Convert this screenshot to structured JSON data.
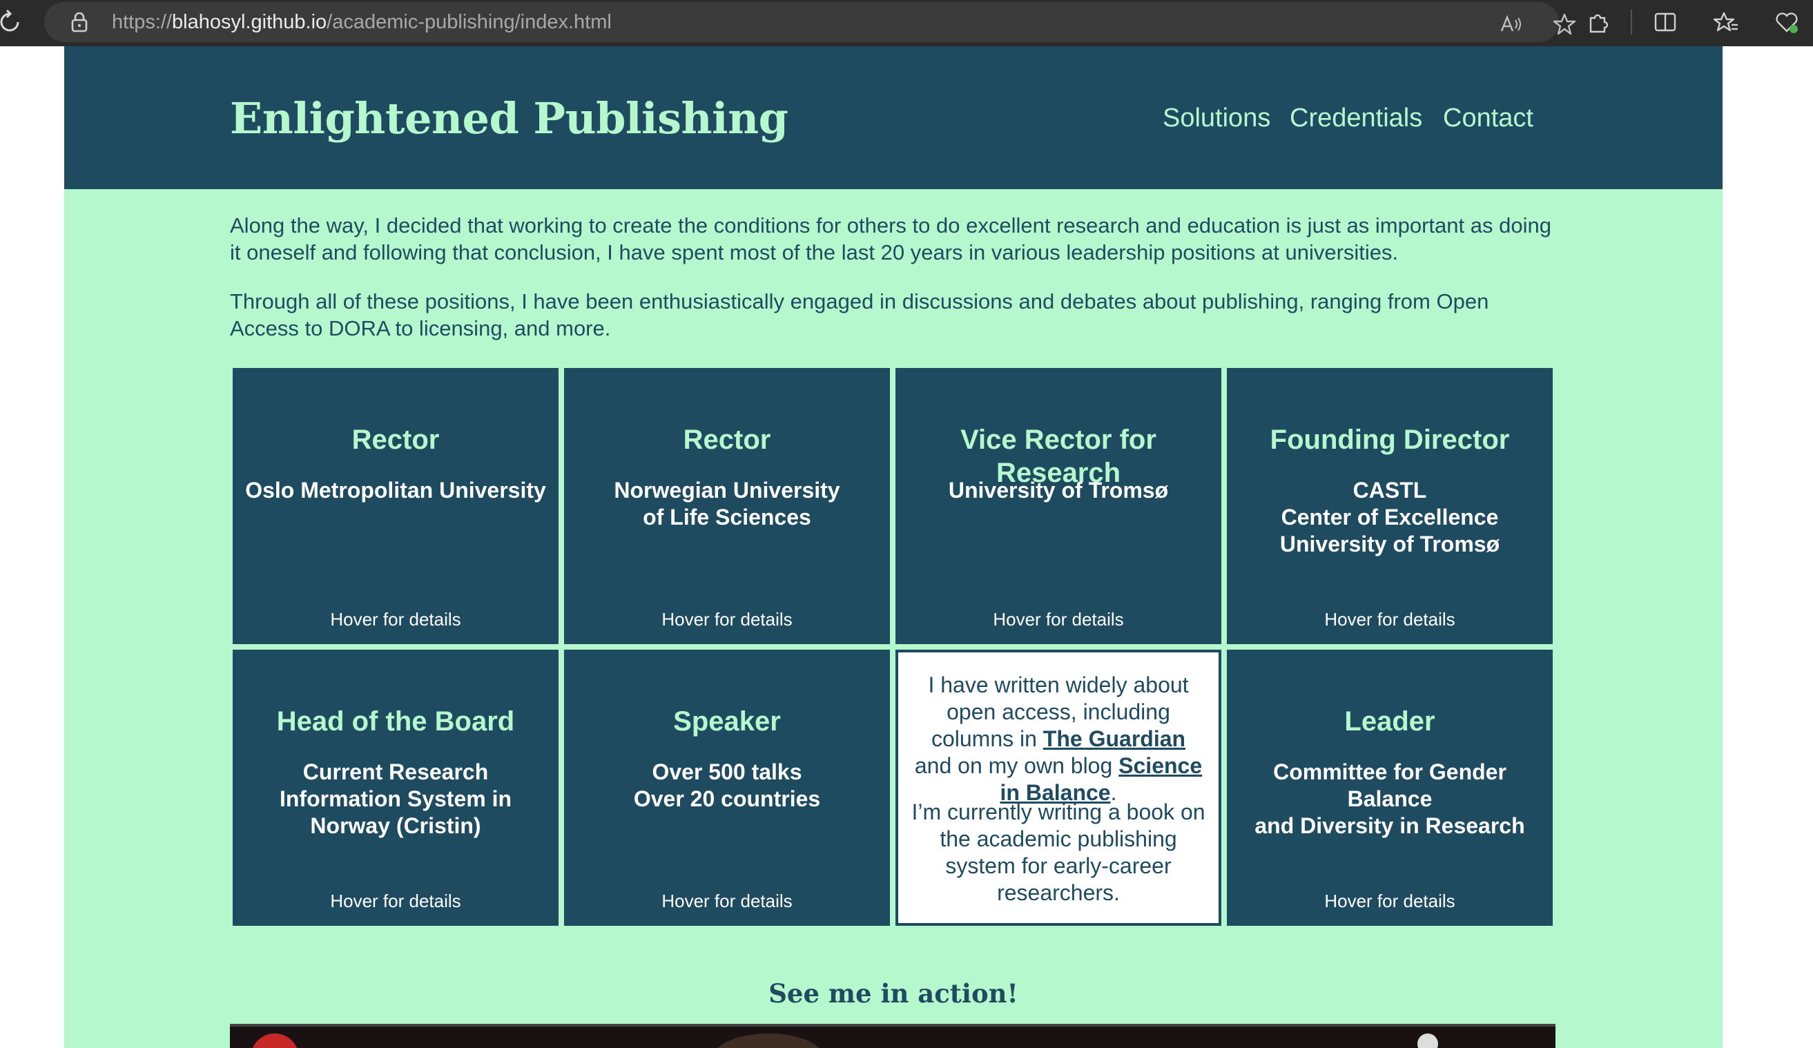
{
  "browser": {
    "url_scheme": "https://",
    "url_host": "blahosyl.github.io",
    "url_path": "/academic-publishing/index.html"
  },
  "site": {
    "title": "Enlightened Publishing",
    "nav": [
      "Solutions",
      "Credentials",
      "Contact"
    ]
  },
  "intro": {
    "p1": "Along the way, I decided that working to create the conditions for others to do excellent research and education is just as important as doing it oneself and following that conclusion, I have spent most of the last 20 years in various leadership positions at universities.",
    "p2": "Through all of these positions, I have been enthusiastically engaged in discussions and debates about publishing, ranging from Open Access to DORA to licensing, and more."
  },
  "cards": [
    {
      "title": "Rector",
      "sub": "Oslo Metropolitan University",
      "hover": "Hover for details"
    },
    {
      "title": "Rector",
      "sub": "Norwegian University\nof Life Sciences",
      "hover": "Hover for details"
    },
    {
      "title": "Vice Rector for Research",
      "sub": "University of Tromsø",
      "hover": "Hover for details"
    },
    {
      "title": "Founding Director",
      "sub": "CASTL\nCenter of Excellence\nUniversity of Tromsø",
      "hover": "Hover for details"
    },
    {
      "title": "Head of the Board",
      "sub": "Current Research Information System in Norway (Cristin)",
      "hover": "Hover for details"
    },
    {
      "title": "Speaker",
      "sub": "Over 500 talks\nOver 20 countries",
      "hover": "Hover for details"
    },
    {
      "title": "Leader",
      "sub": "Committee for Gender Balance\nand Diversity in Research",
      "hover": "Hover for details"
    }
  ],
  "writing_card": {
    "text_a": "I have written widely about open access, including columns in ",
    "link_guardian": "The Guardian",
    "text_b": " and on my own blog ",
    "link_blog": "Science in Balance",
    "text_c": ".",
    "book": "I’m currently writing a book on the academic publishing system for early-career researchers."
  },
  "action_heading": "See me in action!",
  "colors": {
    "dark_teal": "#1f4b61",
    "mint": "#b6f8cd"
  }
}
